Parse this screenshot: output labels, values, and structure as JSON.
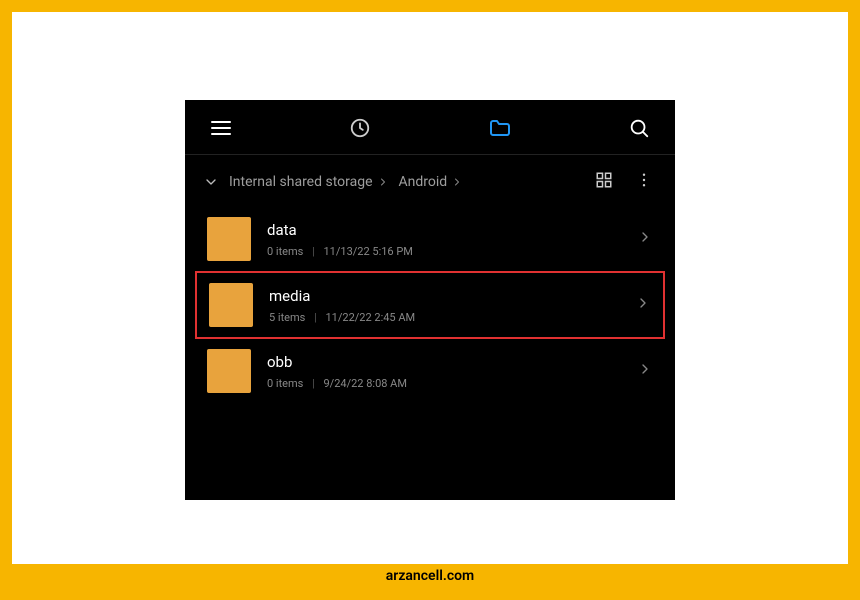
{
  "breadcrumb": {
    "root": "Internal shared storage",
    "path": [
      "Android"
    ]
  },
  "folders": [
    {
      "name": "data",
      "items": "0 items",
      "date": "11/13/22 5:16 PM",
      "highlighted": false
    },
    {
      "name": "media",
      "items": "5 items",
      "date": "11/22/22 2:45 AM",
      "highlighted": true
    },
    {
      "name": "obb",
      "items": "0 items",
      "date": "9/24/22 8:08 AM",
      "highlighted": false
    }
  ],
  "watermark": "arzancell.com",
  "colors": {
    "frame": "#f7b500",
    "highlight": "#e03131",
    "folder": "#e8a33d",
    "activeTab": "#2196f3"
  }
}
